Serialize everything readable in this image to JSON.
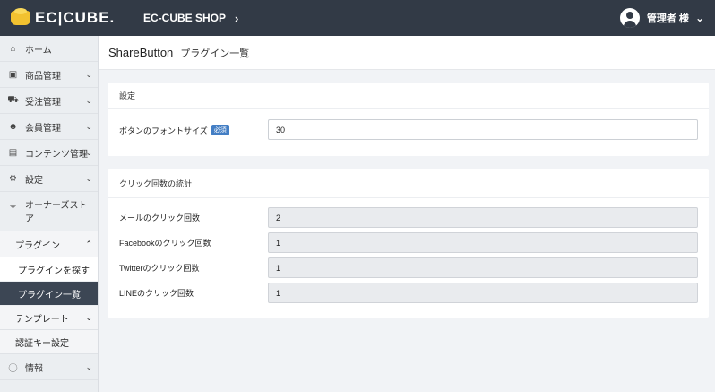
{
  "header": {
    "logo_text": "EC|CUBE.",
    "shop_name": "EC-CUBE SHOP",
    "shop_chevron": "›",
    "user_name": "管理者 様",
    "user_chevron": "⌄"
  },
  "sidebar": {
    "items": [
      {
        "label": "ホーム",
        "icon": "home-icon",
        "glyph": "⌂"
      },
      {
        "label": "商品管理",
        "icon": "box-icon",
        "glyph": "▣"
      },
      {
        "label": "受注管理",
        "icon": "cart-icon",
        "glyph": "⛟"
      },
      {
        "label": "会員管理",
        "icon": "users-icon",
        "glyph": "☻"
      },
      {
        "label": "コンテンツ管理",
        "icon": "file-icon",
        "glyph": "▤"
      },
      {
        "label": "設定",
        "icon": "gear-icon",
        "glyph": "⚙"
      },
      {
        "label": "オーナーズストア",
        "icon": "plug-icon",
        "glyph": "⏚"
      }
    ],
    "plugin_group": "プラグイン",
    "plugin_search": "プラグインを探す",
    "plugin_list": "プラグイン一覧",
    "template": "テンプレート",
    "auth_key": "認証キー設定",
    "info": {
      "label": "情報",
      "icon": "info-icon",
      "glyph": "ⓘ"
    },
    "chevron_down": "⌄",
    "chevron_up": "⌃"
  },
  "page": {
    "title": "ShareButton",
    "subtitle": "プラグイン一覧"
  },
  "settings_card": {
    "header": "設定",
    "font_size_label": "ボタンのフォントサイズ",
    "required_badge": "必須",
    "font_size_value": "30"
  },
  "stats_card": {
    "header": "クリック回数の統計",
    "rows": [
      {
        "label": "メールのクリック回数",
        "value": "2"
      },
      {
        "label": "Facebookのクリック回数",
        "value": "1"
      },
      {
        "label": "Twitterのクリック回数",
        "value": "1"
      },
      {
        "label": "LINEのクリック回数",
        "value": "1"
      }
    ]
  }
}
